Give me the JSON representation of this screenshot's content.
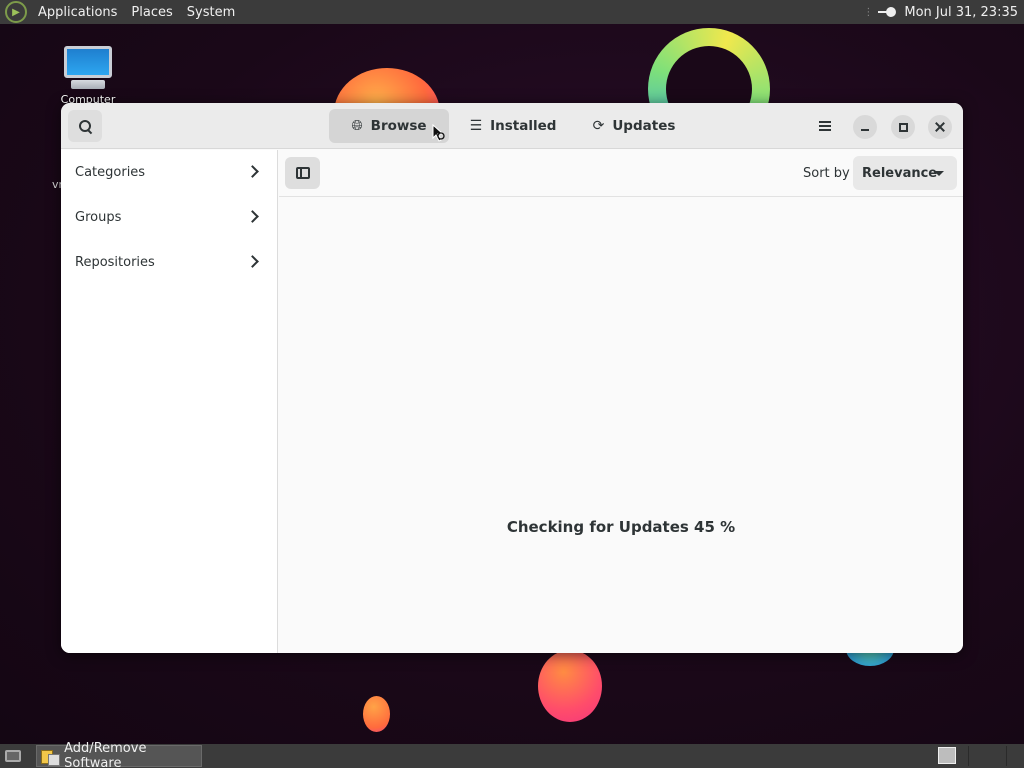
{
  "top_panel": {
    "menus": [
      "Applications",
      "Places",
      "System"
    ],
    "clock": "Mon Jul 31, 23:35"
  },
  "desktop": {
    "icon_label": "Computer",
    "stray_text": "vr"
  },
  "window": {
    "tabs": [
      {
        "label": "Browse",
        "icon": "globe-icon",
        "active": true
      },
      {
        "label": "Installed",
        "icon": "list-icon",
        "active": false
      },
      {
        "label": "Updates",
        "icon": "refresh-icon",
        "active": false
      }
    ],
    "sidebar": {
      "items": [
        {
          "label": "Categories"
        },
        {
          "label": "Groups"
        },
        {
          "label": "Repositories"
        }
      ]
    },
    "toolbar": {
      "sort_label": "Sort by",
      "sort_value": "Relevance"
    },
    "status_message": "Checking for Updates 45 %"
  },
  "taskbar": {
    "task_label": "Add/Remove Software"
  },
  "colors": {
    "panel_bg": "#3b3b3b",
    "window_bg": "#fafafa",
    "active_tab_bg": "#d5d5d5"
  }
}
